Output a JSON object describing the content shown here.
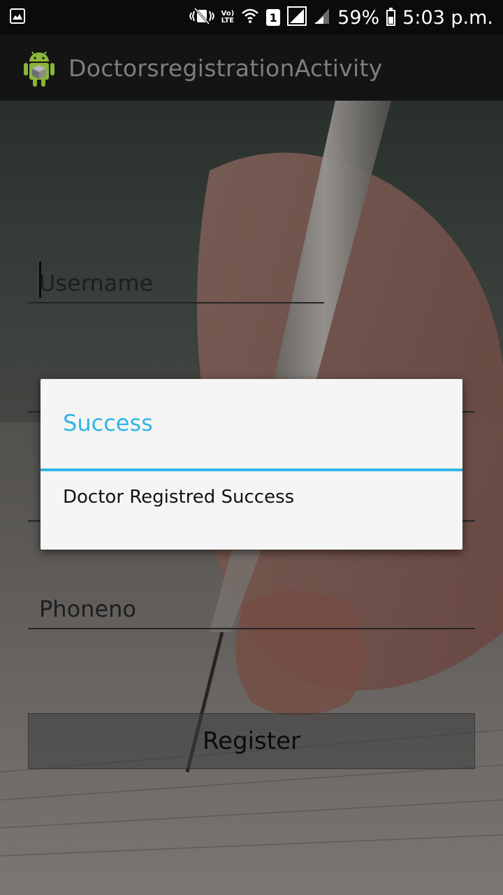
{
  "status_bar": {
    "lte_top": "Vo)",
    "lte_bottom": "LTE",
    "sim_slot": "1",
    "battery": "59%",
    "battery_level": 0.59,
    "time": "5:03 p.m."
  },
  "app_bar": {
    "title": "DoctorsregistrationActivity"
  },
  "form": {
    "username_placeholder": "Username",
    "phoneno_placeholder": "Phoneno",
    "register_label": "Register"
  },
  "dialog": {
    "title": "Success",
    "message": "Doctor Registred Success"
  },
  "colors": {
    "accent": "#33b5e5",
    "status_bar": "#0b0b0b",
    "app_bar": "#141414",
    "dialog_bg": "#f5f5f5"
  }
}
